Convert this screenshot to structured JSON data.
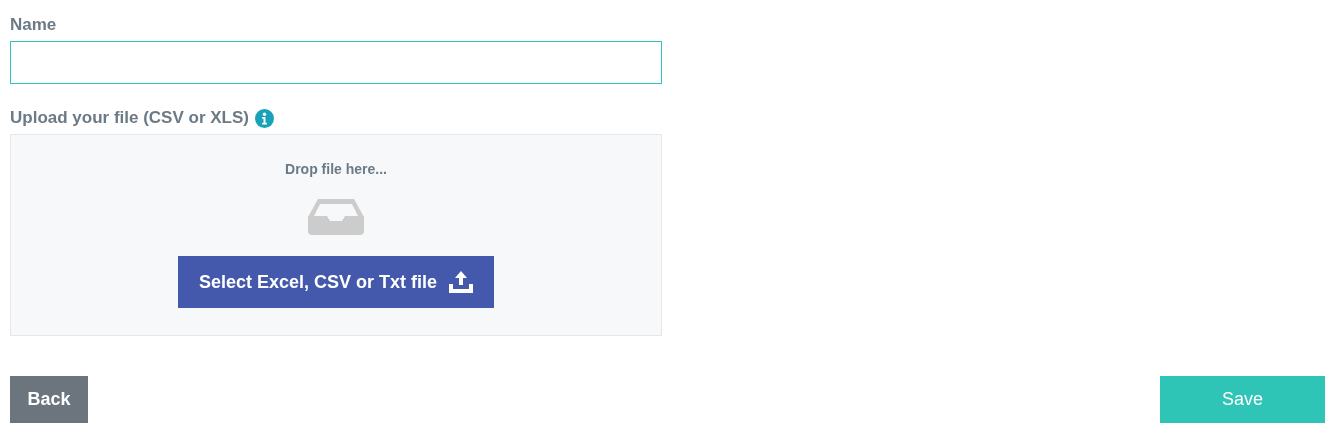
{
  "name_field": {
    "label": "Name"
  },
  "upload": {
    "label": "Upload your file (CSV or XLS)",
    "drop_text": "Drop file here...",
    "select_button": "Select Excel, CSV or Txt file"
  },
  "buttons": [
    {
      "kind": "back",
      "label": "Back"
    },
    {
      "kind": "save",
      "label": "Save"
    }
  ]
}
